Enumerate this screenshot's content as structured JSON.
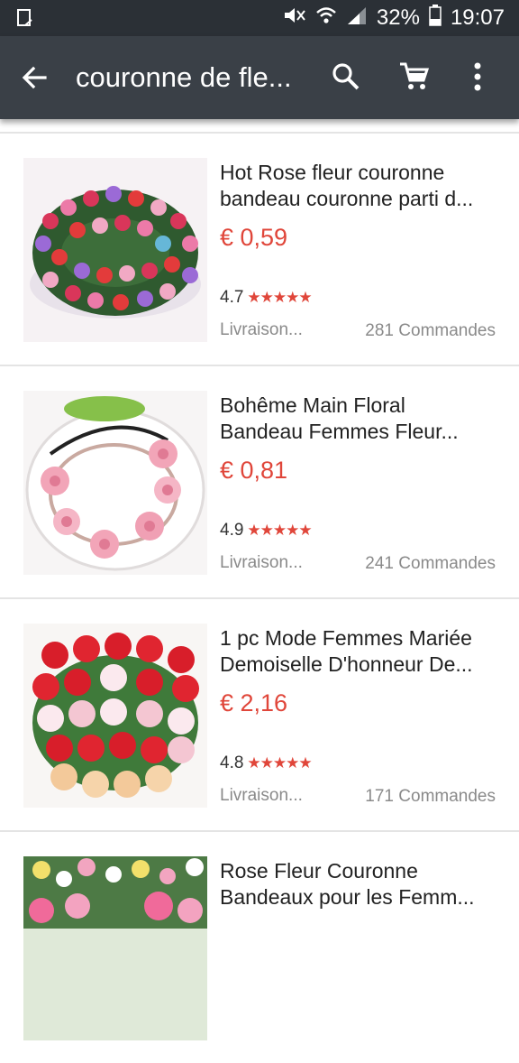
{
  "status_bar": {
    "battery": "32%",
    "time": "19:07"
  },
  "app_bar": {
    "title": "couronne de fle..."
  },
  "products": [
    {
      "title_line1": "Hot Rose fleur couronne",
      "title_line2": "bandeau couronne parti d...",
      "price": "€ 0,59",
      "rating": "4.7",
      "stars": "★★★★★",
      "shipping": "Livraison...",
      "orders": "281 Commandes"
    },
    {
      "title_line1": "Bohême Main Floral",
      "title_line2": "Bandeau Femmes Fleur...",
      "price": "€ 0,81",
      "rating": "4.9",
      "stars": "★★★★★",
      "shipping": "Livraison...",
      "orders": "241 Commandes"
    },
    {
      "title_line1": "1 pc Mode Femmes Mariée",
      "title_line2": "Demoiselle D'honneur De...",
      "price": "€ 2,16",
      "rating": "4.8",
      "stars": "★★★★★",
      "shipping": "Livraison...",
      "orders": "171 Commandes"
    },
    {
      "title_line1": "Rose Fleur Couronne",
      "title_line2": "Bandeaux pour les Femm...",
      "price": "",
      "rating": "",
      "stars": "",
      "shipping": "",
      "orders": ""
    }
  ],
  "colors": {
    "status_bar": "#2b3036",
    "app_bar": "#3a4047",
    "price": "#e0463a"
  },
  "icons": [
    "notification-icon",
    "mute-icon",
    "wifi-icon",
    "signal-icon",
    "battery-icon",
    "back-arrow-icon",
    "search-icon",
    "cart-icon",
    "more-vert-icon",
    "star-icon"
  ]
}
